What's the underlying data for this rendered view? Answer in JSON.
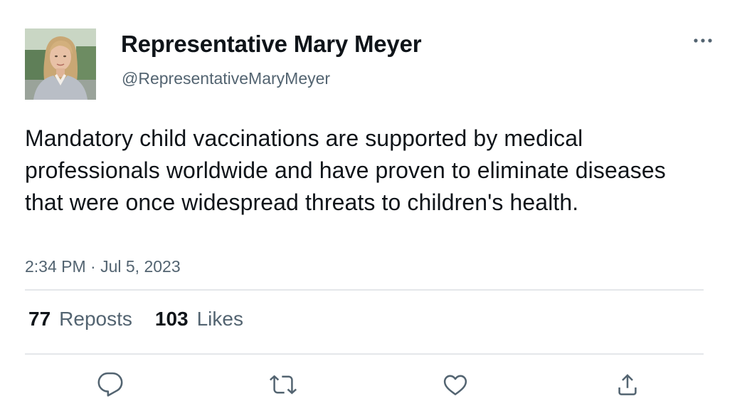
{
  "author": {
    "display_name": "Representative Mary Meyer",
    "handle": "@RepresentativeMaryMeyer"
  },
  "tweet": {
    "text": "Mandatory child vaccinations are supported by medical professionals worldwide and have proven to eliminate diseases that were once widespread threats to children's health.",
    "timestamp": "2:34 PM · Jul 5, 2023"
  },
  "stats": {
    "reposts_count": "77",
    "reposts_label": "Reposts",
    "likes_count": "103",
    "likes_label": "Likes"
  },
  "icons": {
    "more": "more-horizontal-icon",
    "reply": "reply-icon",
    "repost": "repost-icon",
    "like": "heart-icon",
    "share": "share-icon"
  },
  "colors": {
    "text_primary": "#0f1419",
    "text_secondary": "#536471",
    "divider": "#e4e7ea"
  }
}
